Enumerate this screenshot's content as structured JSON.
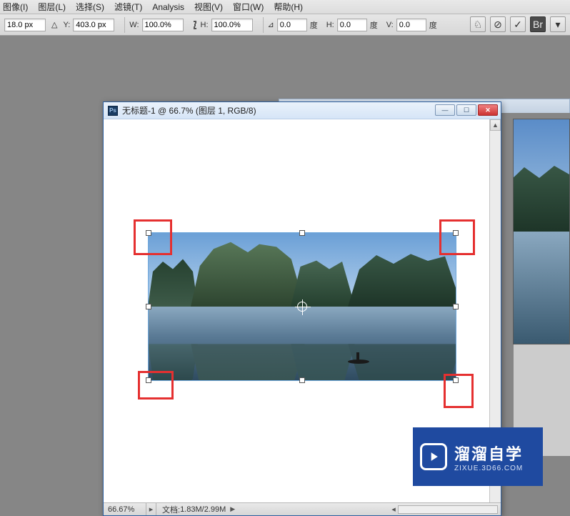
{
  "menu": {
    "image": "图像(I)",
    "layer": "图层(L)",
    "select": "选择(S)",
    "filter": "滤镜(T)",
    "analysis": "Analysis",
    "view": "视图(V)",
    "window": "窗口(W)",
    "help": "帮助(H)"
  },
  "options": {
    "x_value": "18.0 px",
    "y_label": "Y:",
    "y_value": "403.0 px",
    "w_label": "W:",
    "w_value": "100.0%",
    "h_label": "H:",
    "h_value": "100.0%",
    "angle_value": "0.0",
    "angle_unit": "度",
    "skew_h_label": "H:",
    "skew_h_value": "0.0",
    "skew_h_unit": "度",
    "skew_v_label": "V:",
    "skew_v_value": "0.0",
    "skew_v_unit": "度",
    "commit": "✓",
    "cancel": "⊘",
    "warp": "♘",
    "br_label": "Br"
  },
  "document": {
    "title": "无标题-1 @ 66.7% (图层 1, RGB/8)",
    "zoom": "66.67%",
    "docinfo_label": "文档:",
    "docinfo": "1.83M/2.99M"
  },
  "banner": {
    "title": "溜溜自学",
    "subtitle": "ZIXUE.3D66.COM"
  }
}
